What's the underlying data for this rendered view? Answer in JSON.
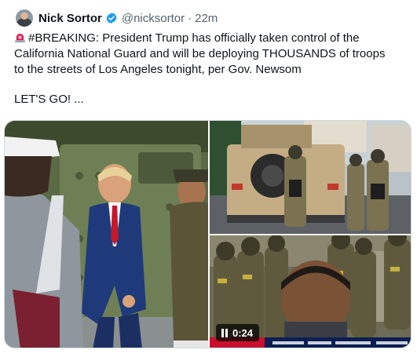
{
  "post": {
    "author_name": "Nick Sortor",
    "handle": "@nicksortor",
    "separator": "·",
    "timestamp": "22m",
    "line1": "#BREAKING: President Trump has officially taken control of the",
    "line2": "California National Guard and will be deploying THOUSANDS of troops",
    "line3": "to the streets of Los Angeles tonight, per Gov. Newsom",
    "line4": "LET'S GO! ...",
    "icons": {
      "avatar": "author-avatar",
      "verified": "verified-badge-icon",
      "siren": "siren-emoji-icon"
    }
  },
  "media": {
    "video_time": "0:24",
    "icons": {
      "pause": "pause-icon"
    },
    "colors": {
      "verified_blue": "#1d9bf0",
      "siren_red": "#e0245e"
    }
  }
}
